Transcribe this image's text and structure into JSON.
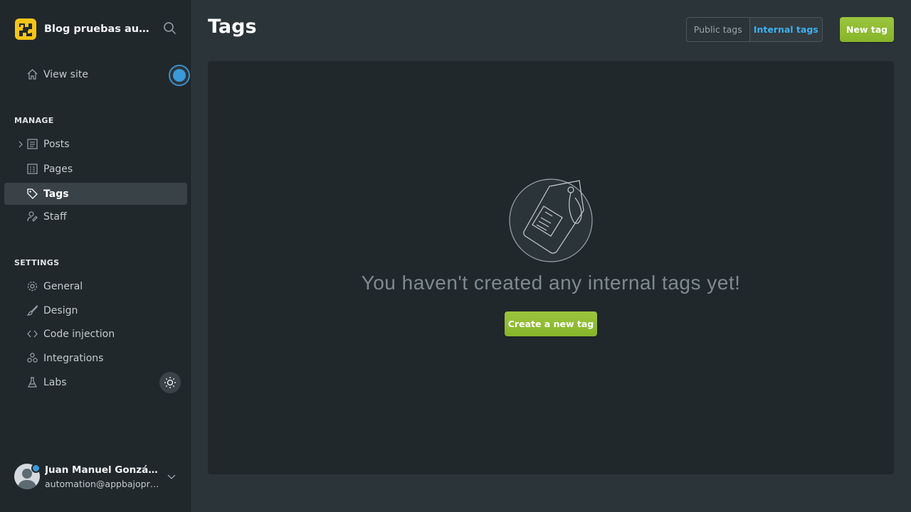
{
  "sidebar": {
    "blog_title": "Blog pruebas automatizadas",
    "view_site": "View site",
    "manage_label": "MANAGE",
    "settings_label": "SETTINGS",
    "manage_items": [
      {
        "label": "Posts",
        "icon": "posts-icon"
      },
      {
        "label": "Pages",
        "icon": "pages-icon"
      },
      {
        "label": "Tags",
        "icon": "tag-icon",
        "active": true
      },
      {
        "label": "Staff",
        "icon": "staff-icon"
      }
    ],
    "settings_items": [
      {
        "label": "General",
        "icon": "gear-icon"
      },
      {
        "label": "Design",
        "icon": "brush-icon"
      },
      {
        "label": "Code injection",
        "icon": "code-icon"
      },
      {
        "label": "Integrations",
        "icon": "integrations-icon"
      },
      {
        "label": "Labs",
        "icon": "flask-icon"
      }
    ],
    "user": {
      "name": "Juan Manuel González Hernández",
      "email": "automation@appbajopruebas.com"
    }
  },
  "header": {
    "title": "Tags",
    "public_tags": "Public tags",
    "internal_tags": "Internal tags",
    "new_tag": "New tag"
  },
  "main": {
    "empty_message": "You haven't created any internal tags yet!",
    "create_button": "Create a new tag"
  },
  "colors": {
    "accent_green": "#9bc53d",
    "accent_blue": "#3eb0ef",
    "sidebar_bg": "#21282c",
    "content_bg": "#2b3439"
  }
}
